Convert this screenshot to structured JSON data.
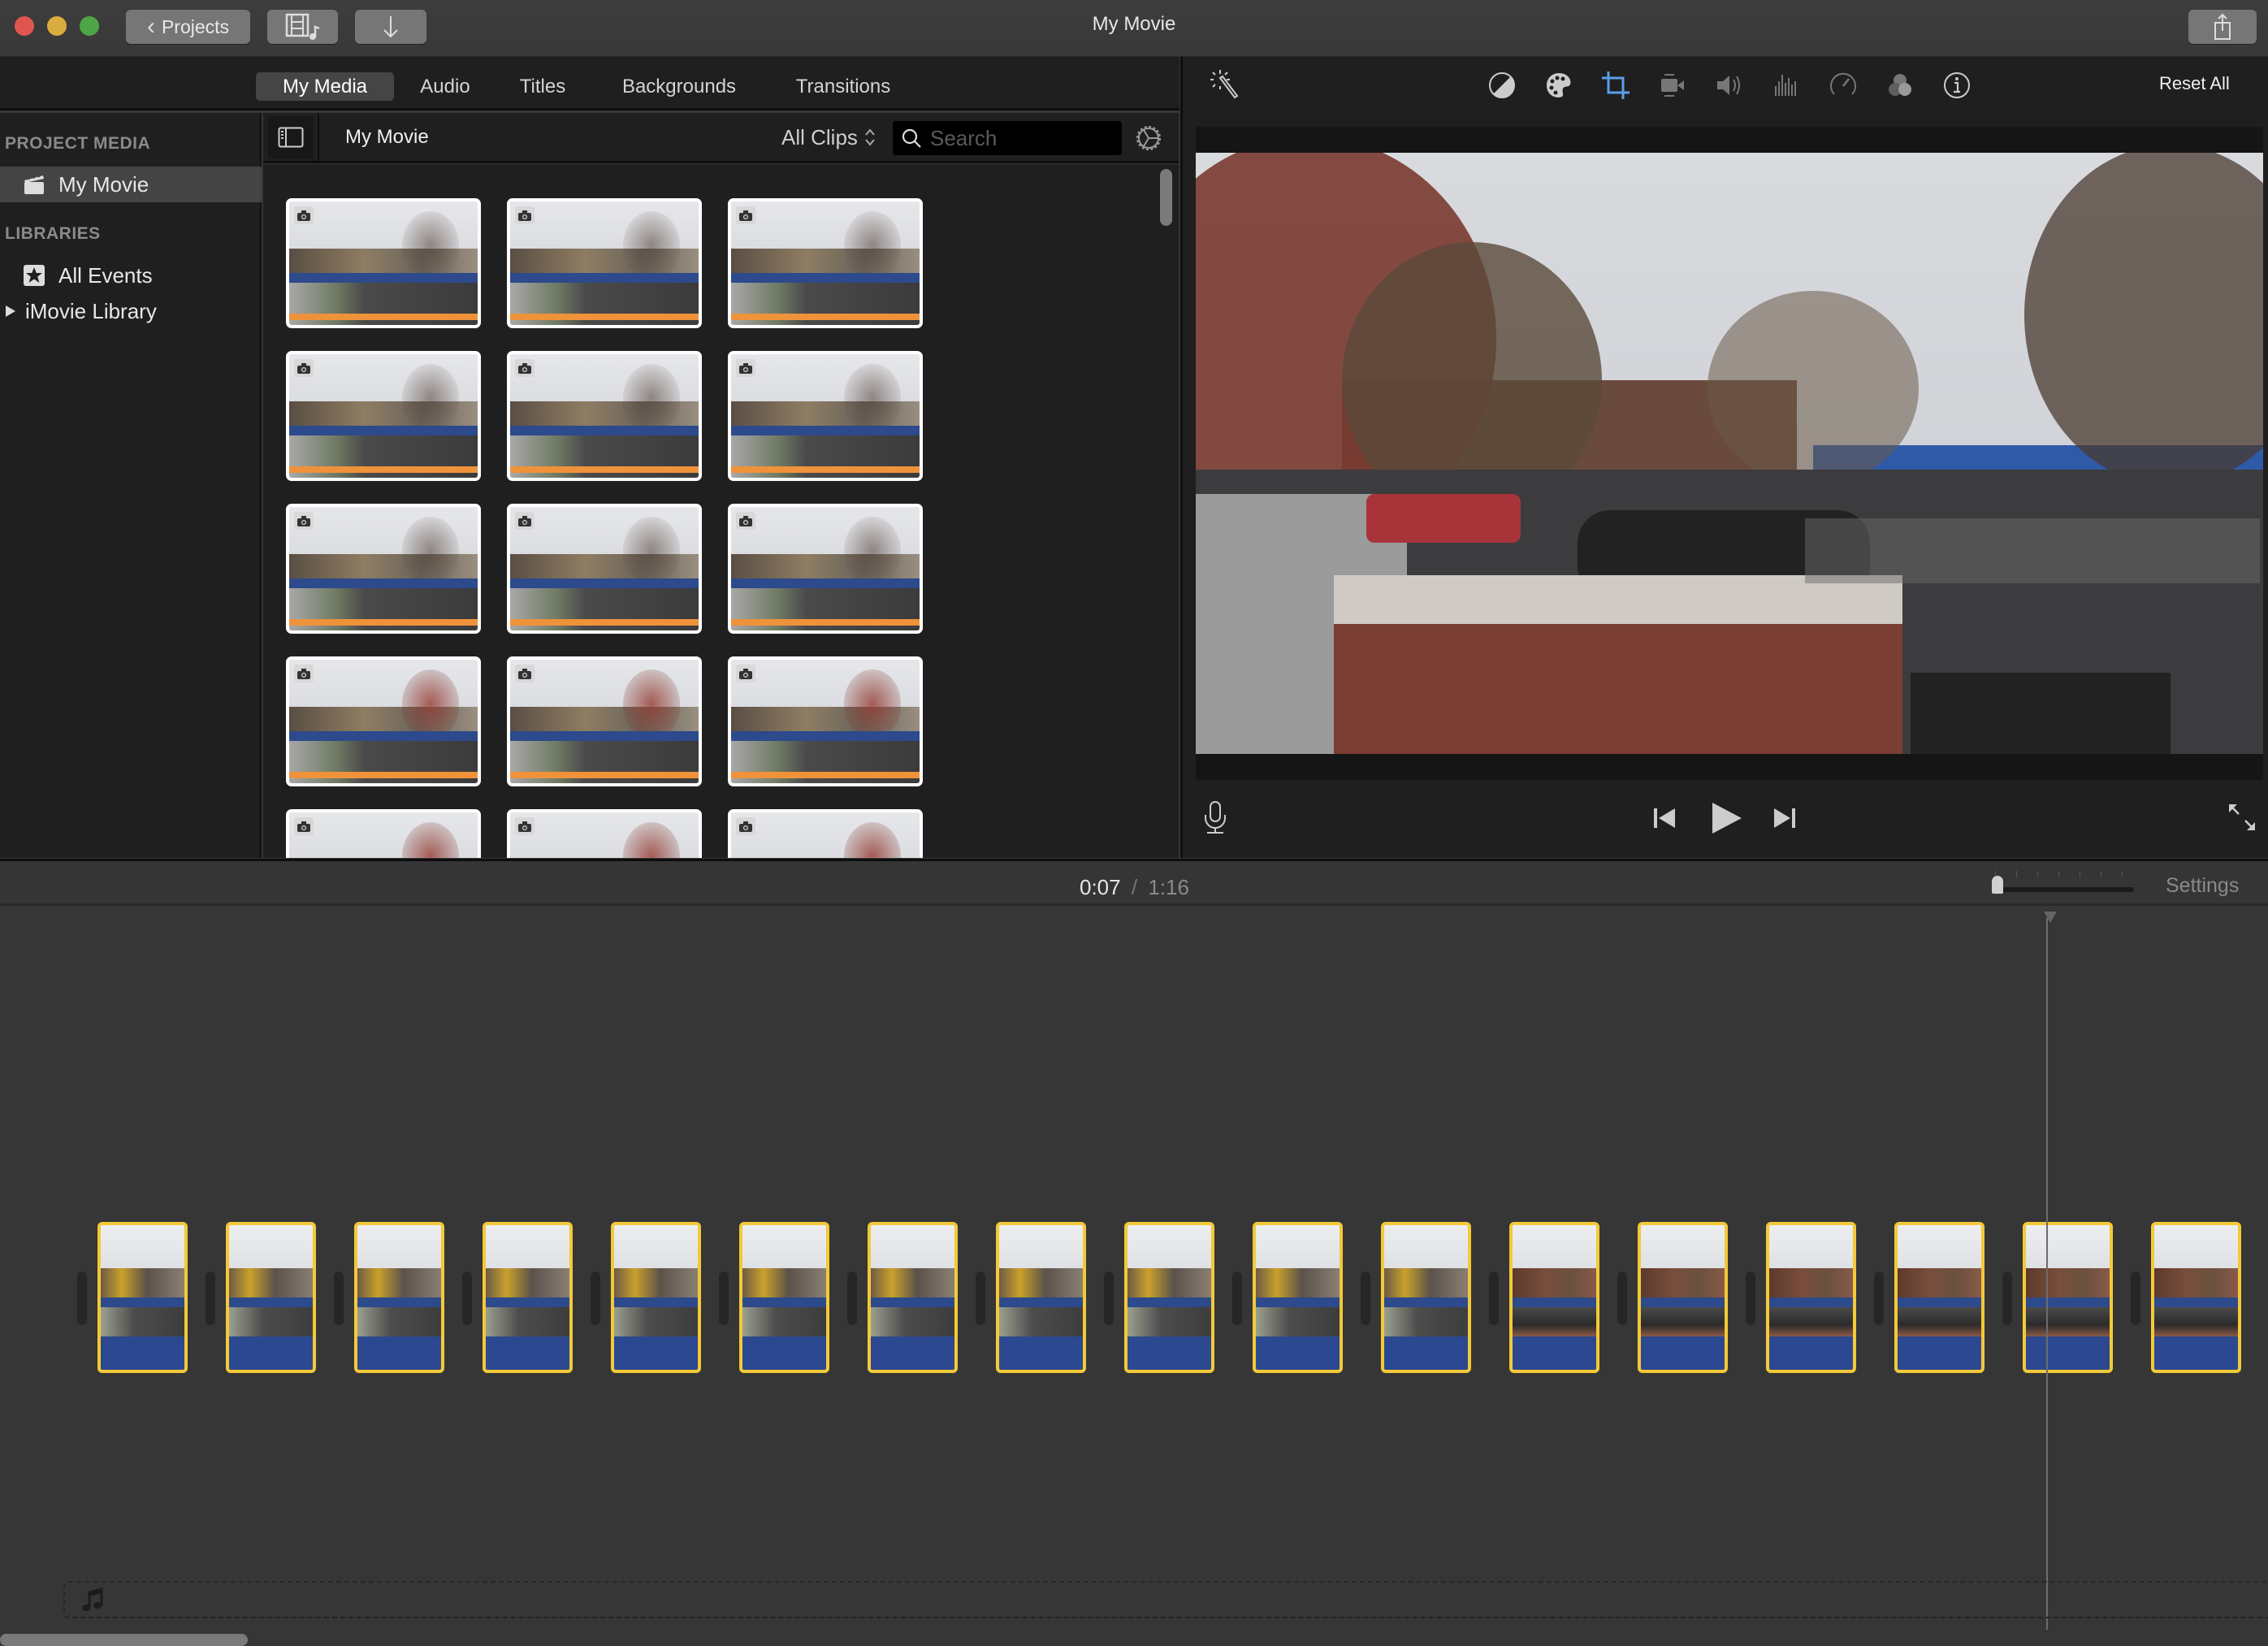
{
  "window": {
    "title": "My Movie",
    "traffic_lights": {
      "close": "#e0564f",
      "minimize": "#d9ac3e",
      "zoom": "#4ea546"
    },
    "buttons": {
      "projects_label": "Projects",
      "media_icon": "film-music-icon",
      "import_icon": "download-arrow-icon",
      "share_icon": "share-icon"
    }
  },
  "browser_tabs": [
    {
      "label": "My Media",
      "active": true
    },
    {
      "label": "Audio",
      "active": false
    },
    {
      "label": "Titles",
      "active": false
    },
    {
      "label": "Backgrounds",
      "active": false
    },
    {
      "label": "Transitions",
      "active": false
    }
  ],
  "sidebar": {
    "project_media_heading": "PROJECT MEDIA",
    "project_items": [
      {
        "label": "My Movie",
        "icon": "clapperboard-icon",
        "selected": true
      }
    ],
    "libraries_heading": "LIBRARIES",
    "library_items": [
      {
        "label": "All Events",
        "icon": "star-icon"
      },
      {
        "label": "iMovie Library",
        "icon": "disclosure-triangle-icon"
      }
    ]
  },
  "media_browser": {
    "title": "My Movie",
    "filter_label": "All Clips",
    "search_placeholder": "Search",
    "thumbnail_count_visible": 15,
    "accent_bar_color": "#ef923a"
  },
  "viewer": {
    "toolbar": {
      "reset_label": "Reset All",
      "tools": [
        {
          "name": "color-balance-icon",
          "active": false
        },
        {
          "name": "color-correction-icon",
          "active": false
        },
        {
          "name": "crop-icon",
          "active": true
        },
        {
          "name": "stabilization-icon",
          "active": false
        },
        {
          "name": "volume-icon",
          "active": false
        },
        {
          "name": "noise-reduction-icon",
          "active": false
        },
        {
          "name": "speed-icon",
          "active": false
        },
        {
          "name": "clip-filter-icon",
          "active": false
        },
        {
          "name": "info-icon",
          "active": false
        }
      ],
      "active_color": "#5b9ee8"
    }
  },
  "timeline": {
    "current_time": "0:07",
    "separator": "/",
    "total_time": "1:16",
    "settings_label": "Settings",
    "zoom_level": 0.0,
    "clip_count": 17,
    "clip_border_color": "#f3c937",
    "audio_color": "#2c4890",
    "playhead_position_fraction": 0.09
  }
}
